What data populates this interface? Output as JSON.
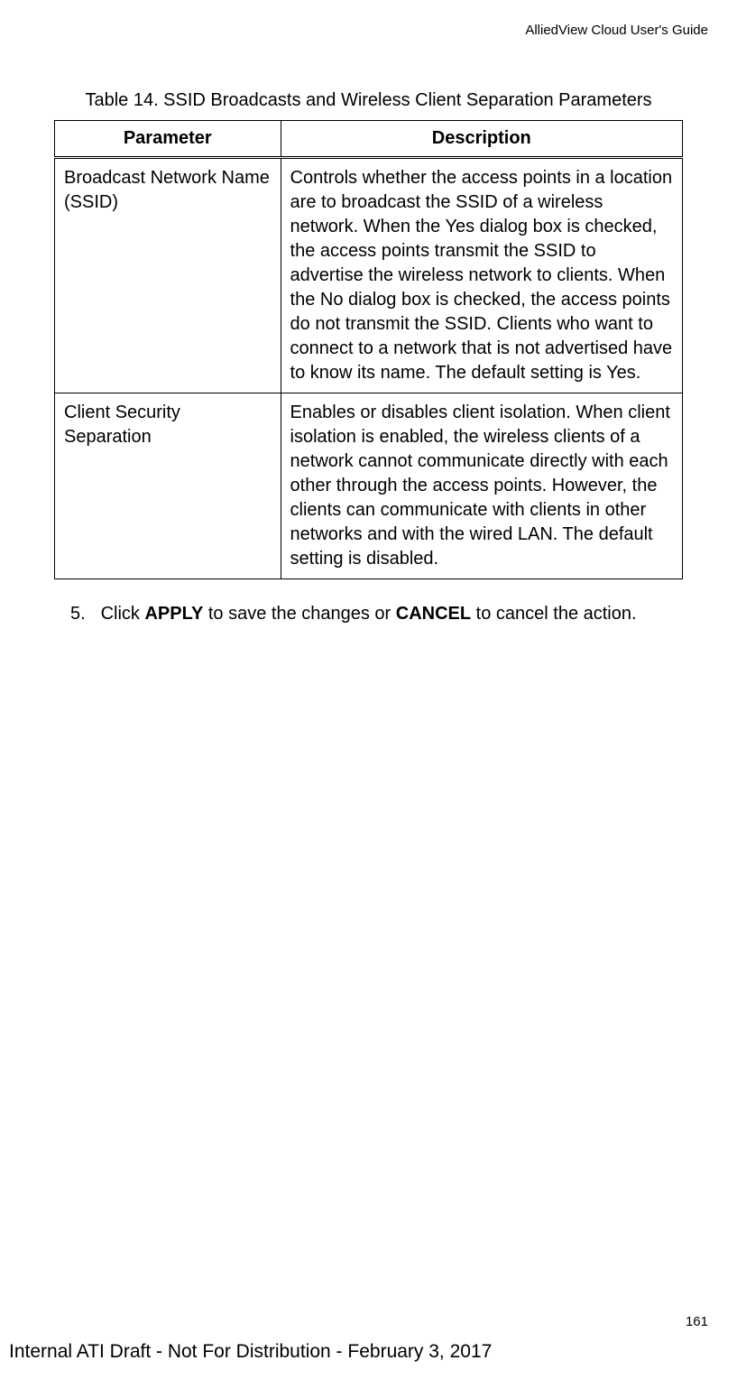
{
  "header": {
    "guideTitle": "AlliedView Cloud User's Guide"
  },
  "table": {
    "caption": "Table 14. SSID Broadcasts and Wireless Client Separation Parameters",
    "headers": {
      "parameter": "Parameter",
      "description": "Description"
    },
    "rows": [
      {
        "parameter": "Broadcast Network Name (SSID)",
        "description": "Controls whether the access points in a location are to broadcast the SSID of a wireless network. When the Yes dialog box is checked, the access points transmit the SSID to advertise the wireless network to clients. When the No dialog box is checked, the access points do not transmit the SSID. Clients who want to connect to a network that is not advertised have to know its name. The default setting is Yes."
      },
      {
        "parameter": "Client Security Separation",
        "description": "Enables or disables client isolation. When client isolation is enabled, the wireless clients of a network cannot communicate directly with each other through the access points. However, the clients can communicate with clients in other networks and with the wired LAN. The default setting is disabled."
      }
    ]
  },
  "step": {
    "number": "5.",
    "prefix": "Click ",
    "bold1": "APPLY",
    "mid": " to save the changes or ",
    "bold2": "CANCEL",
    "suffix": " to cancel the action."
  },
  "pageNumber": "161",
  "footer": "Internal ATI Draft - Not For Distribution - February 3, 2017"
}
